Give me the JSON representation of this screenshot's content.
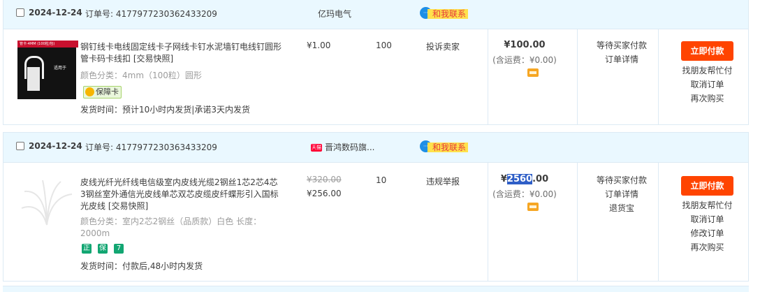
{
  "orders": [
    {
      "date": "2024-12-24",
      "order_no": "订单号: 4177977230362433209",
      "shop": "亿玛电气",
      "contact": "和我联系",
      "contact_icon": "chat-bubble-icon",
      "thumb_caption_top": "管卡-4MM (100粒/包)",
      "thumb_caption_side": "适用于",
      "title": "钢钉线卡电线固定线卡子网线卡钉水泥墙钉电线钉圆形管卡码卡线扣 [交易快照]",
      "sku": "颜色分类：4mm（100粒）圆形",
      "tags": [
        "保障卡"
      ],
      "ship_time": "发货时间：预计10小时内发货|承诺3天内发货",
      "unit_price": "¥1.00",
      "quantity": "100",
      "service": "投诉卖家",
      "total": "¥100.00",
      "postage": "(含运费：¥0.00)",
      "status": [
        "等待买家付款",
        "订单详情"
      ],
      "pay_button": "立即付款",
      "ops": [
        "找朋友帮忙付",
        "取消订单",
        "再次购买"
      ]
    },
    {
      "date": "2024-12-24",
      "order_no": "订单号: 4177977230363433209",
      "shop_badge": "天猫",
      "shop": "晋鸿数码旗...",
      "contact": "和我联系",
      "contact_icon": "chat-bubble-icon",
      "title": "皮线光纤光纤线电信级室内皮线光缆2钢丝1芯2芯4芯3钢丝室外通信光皮线单芯双芯皮缆皮纤蝶形引入国标光皮线 [交易快照]",
      "sku": "颜色分类：室内2芯2钢丝（品质款）白色  长度：2000m",
      "tag_icons": [
        "正",
        "保",
        "7"
      ],
      "ship_time": "发货时间：付款后,48小时内发货",
      "original_price": "¥320.00",
      "unit_price": "¥256.00",
      "quantity": "10",
      "service": "违规举报",
      "total_prefix": "¥",
      "total_selected": "2560",
      "total_suffix": ".00",
      "postage": "(含运费：¥0.00)",
      "status": [
        "等待买家付款",
        "订单详情",
        "退货宝"
      ],
      "pay_button": "立即付款",
      "ops": [
        "找朋友帮忙付",
        "取消订单",
        "修改订单",
        "再次购买"
      ]
    }
  ],
  "colors": {
    "header_bg": "#eaf8ff",
    "border": "#dceaf4",
    "pay_button": "#ff4400",
    "contact_bg": "#ffe14c",
    "contact_text": "#e4393c",
    "selection": "#2e5ec7"
  }
}
